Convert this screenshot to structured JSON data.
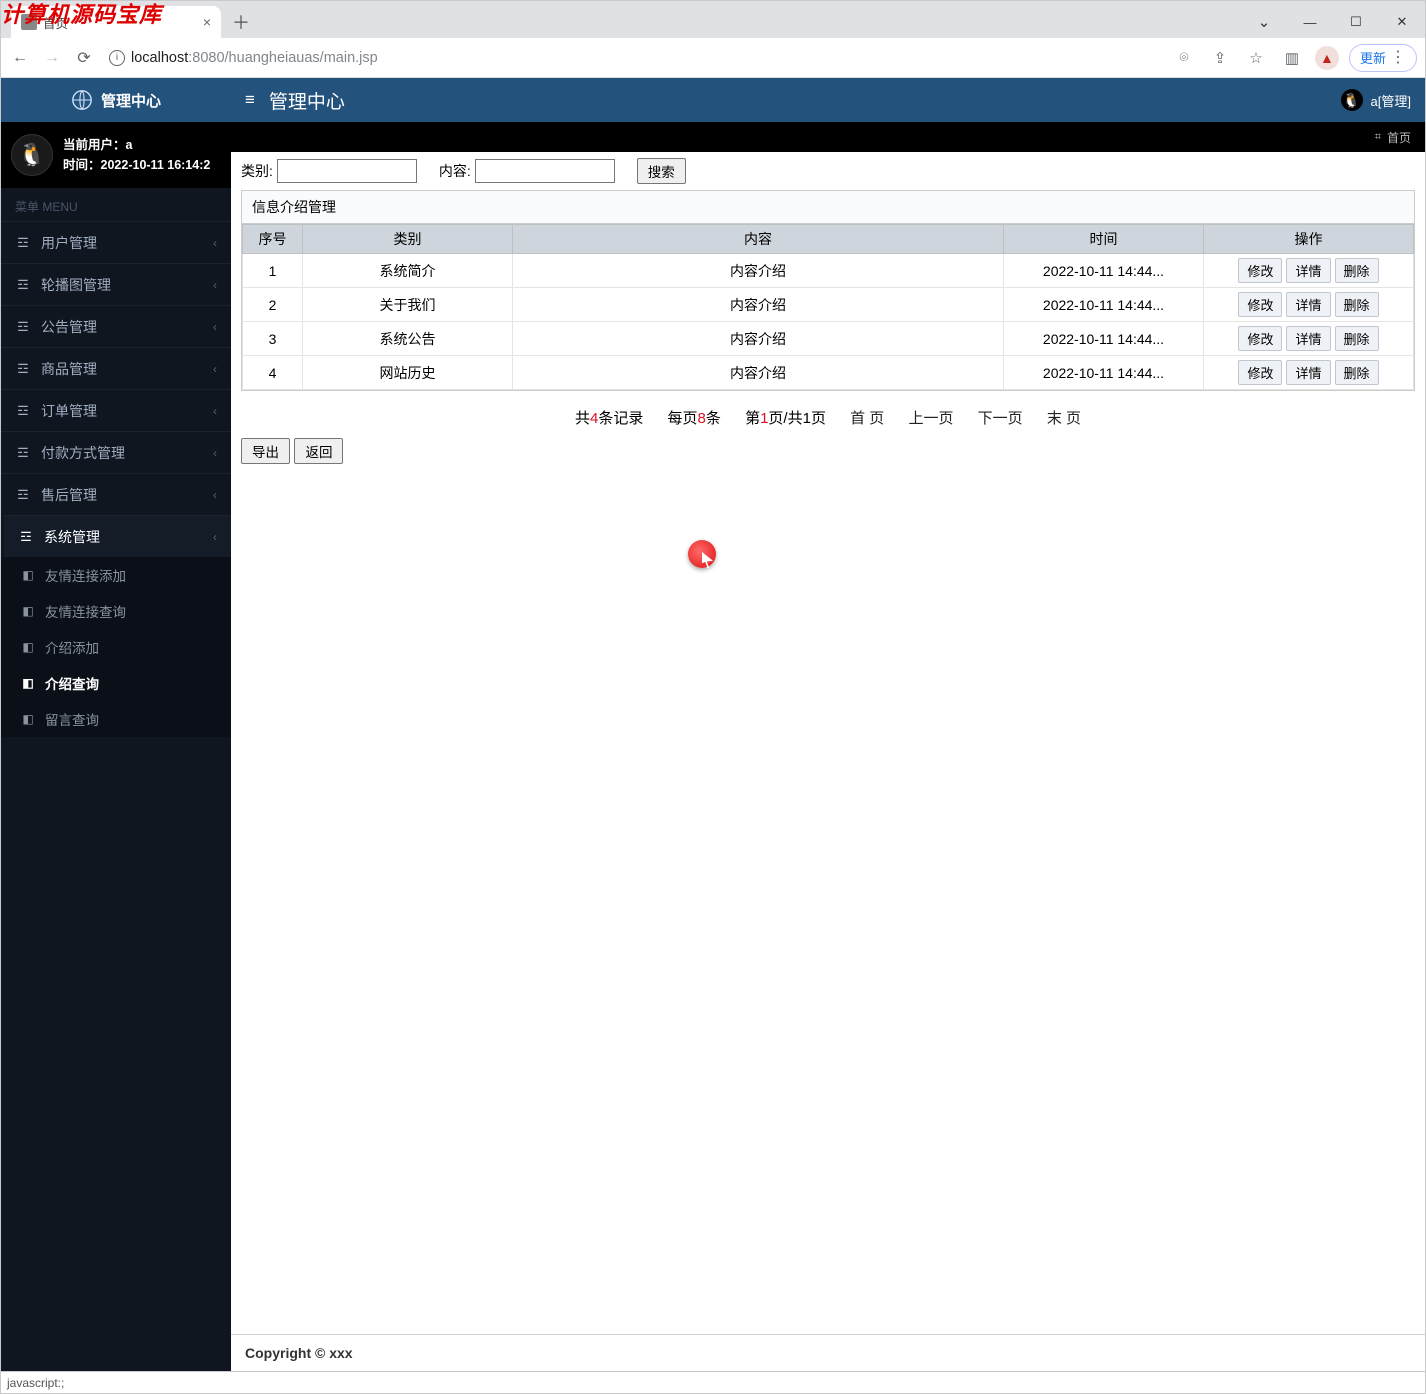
{
  "watermark": "计算机源码宝库",
  "browser": {
    "tab_title": "首页",
    "url_host": "localhost",
    "url_port": ":8080",
    "url_path": "/huangheiauas/main.jsp",
    "update_label": "更新",
    "status_text": "javascript:;"
  },
  "brand": "管理中心",
  "header_title": "管理中心",
  "user_label": "a[管理]",
  "crumb_home": "首页",
  "userbox": {
    "line1_prefix": "当前用户：",
    "line1_value": "a",
    "line2_prefix": "时间：",
    "line2_value": "2022-10-11 16:14:2"
  },
  "menu_header": "菜单 MENU",
  "menu": [
    {
      "label": "用户管理"
    },
    {
      "label": "轮播图管理"
    },
    {
      "label": "公告管理"
    },
    {
      "label": "商品管理"
    },
    {
      "label": "订单管理"
    },
    {
      "label": "付款方式管理"
    },
    {
      "label": "售后管理"
    },
    {
      "label": "系统管理",
      "active": true
    }
  ],
  "submenu": [
    {
      "label": "友情连接添加"
    },
    {
      "label": "友情连接查询"
    },
    {
      "label": "介绍添加"
    },
    {
      "label": "介绍查询",
      "active": true
    },
    {
      "label": "留言查询"
    }
  ],
  "search": {
    "label_category": "类别:",
    "label_content": "内容:",
    "button": "搜索"
  },
  "panel_title": "信息介绍管理",
  "columns": {
    "seq": "序号",
    "cat": "类别",
    "content": "内容",
    "time": "时间",
    "op": "操作"
  },
  "rows": [
    {
      "seq": "1",
      "cat": "系统简介",
      "content": "内容介绍",
      "time": "2022-10-11 14:44..."
    },
    {
      "seq": "2",
      "cat": "关于我们",
      "content": "内容介绍",
      "time": "2022-10-11 14:44..."
    },
    {
      "seq": "3",
      "cat": "系统公告",
      "content": "内容介绍",
      "time": "2022-10-11 14:44..."
    },
    {
      "seq": "4",
      "cat": "网站历史",
      "content": "内容介绍",
      "time": "2022-10-11 14:44..."
    }
  ],
  "op_labels": {
    "edit": "修改",
    "detail": "详情",
    "delete": "删除"
  },
  "pager": {
    "total_prefix": "共",
    "total_num": "4",
    "total_suffix": "条记录",
    "per_prefix": "每页",
    "per_num": "8",
    "per_suffix": "条",
    "page_prefix": "第",
    "page_cur": "1",
    "page_mid": "页/共",
    "page_total": "1",
    "page_suffix": "页",
    "first": "首  页",
    "prev": "上一页",
    "next": "下一页",
    "last": "末  页"
  },
  "below": {
    "export": "导出",
    "back": "返回"
  },
  "footer": "Copyright © xxx"
}
